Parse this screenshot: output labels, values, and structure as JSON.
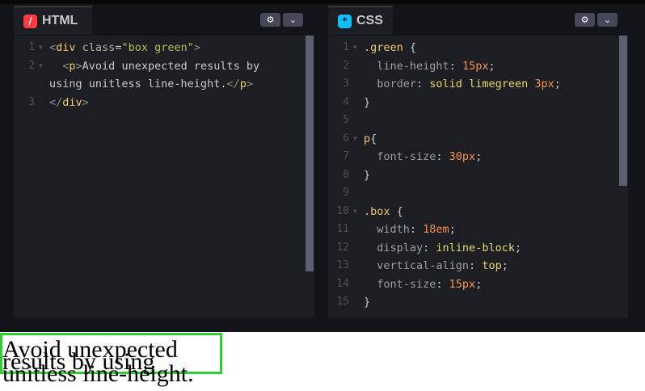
{
  "html_panel": {
    "title": "HTML",
    "icon": "html-icon",
    "icon_glyph": "/",
    "settings_icon": "gear-icon",
    "collapse_icon": "chevron-down-icon",
    "lines": [
      {
        "n": "1",
        "fold": true,
        "segments": [
          {
            "t": "<",
            "c": "tagbr"
          },
          {
            "t": "div",
            "c": "tname"
          },
          {
            "t": " class",
            "c": "attr"
          },
          {
            "t": "=",
            "c": "brace"
          },
          {
            "t": "\"box green\"",
            "c": "str"
          },
          {
            "t": ">",
            "c": "tagbr"
          }
        ]
      },
      {
        "n": "2",
        "fold": true,
        "segments": [
          {
            "t": "  <",
            "c": "tagbr"
          },
          {
            "t": "p",
            "c": "tname"
          },
          {
            "t": ">",
            "c": "tagbr"
          },
          {
            "t": "Avoid unexpected results by",
            "c": "brace"
          }
        ]
      },
      {
        "n": "",
        "fold": false,
        "segments": [
          {
            "t": "using unitless line-height.",
            "c": "brace"
          },
          {
            "t": "</",
            "c": "tagbr"
          },
          {
            "t": "p",
            "c": "tname"
          },
          {
            "t": ">",
            "c": "tagbr"
          }
        ]
      },
      {
        "n": "3",
        "fold": false,
        "segments": [
          {
            "t": "</",
            "c": "tagbr"
          },
          {
            "t": "div",
            "c": "tname"
          },
          {
            "t": ">",
            "c": "tagbr"
          }
        ]
      }
    ]
  },
  "css_panel": {
    "title": "CSS",
    "icon": "css-icon",
    "icon_glyph": "*",
    "settings_icon": "gear-icon",
    "collapse_icon": "chevron-down-icon",
    "lines": [
      {
        "n": "1",
        "fold": true,
        "segments": [
          {
            "t": ".green",
            "c": "sel"
          },
          {
            "t": " {",
            "c": "brace"
          }
        ]
      },
      {
        "n": "2",
        "fold": false,
        "segments": [
          {
            "t": "  line-height",
            "c": "prop2"
          },
          {
            "t": ": ",
            "c": "brace"
          },
          {
            "t": "15px",
            "c": "num"
          },
          {
            "t": ";",
            "c": "brace"
          }
        ]
      },
      {
        "n": "3",
        "fold": false,
        "segments": [
          {
            "t": "  border",
            "c": "prop2"
          },
          {
            "t": ": ",
            "c": "brace"
          },
          {
            "t": "solid",
            "c": "kw"
          },
          {
            "t": " ",
            "c": "brace"
          },
          {
            "t": "limegreen",
            "c": "kw"
          },
          {
            "t": " ",
            "c": "brace"
          },
          {
            "t": "3px",
            "c": "num"
          },
          {
            "t": ";",
            "c": "brace"
          }
        ]
      },
      {
        "n": "4",
        "fold": false,
        "segments": [
          {
            "t": "}",
            "c": "brace"
          }
        ]
      },
      {
        "n": "5",
        "fold": false,
        "segments": []
      },
      {
        "n": "6",
        "fold": true,
        "segments": [
          {
            "t": "p",
            "c": "sel"
          },
          {
            "t": "{",
            "c": "brace"
          }
        ]
      },
      {
        "n": "7",
        "fold": false,
        "segments": [
          {
            "t": "  font-size",
            "c": "prop2"
          },
          {
            "t": ": ",
            "c": "brace"
          },
          {
            "t": "30px",
            "c": "num"
          },
          {
            "t": ";",
            "c": "brace"
          }
        ]
      },
      {
        "n": "8",
        "fold": false,
        "segments": [
          {
            "t": "}",
            "c": "brace"
          }
        ]
      },
      {
        "n": "9",
        "fold": false,
        "segments": []
      },
      {
        "n": "10",
        "fold": true,
        "segments": [
          {
            "t": ".box",
            "c": "sel"
          },
          {
            "t": " {",
            "c": "brace"
          }
        ]
      },
      {
        "n": "11",
        "fold": false,
        "segments": [
          {
            "t": "  width",
            "c": "prop2"
          },
          {
            "t": ": ",
            "c": "brace"
          },
          {
            "t": "18em",
            "c": "num"
          },
          {
            "t": ";",
            "c": "brace"
          }
        ]
      },
      {
        "n": "12",
        "fold": false,
        "segments": [
          {
            "t": "  display",
            "c": "prop2"
          },
          {
            "t": ": ",
            "c": "brace"
          },
          {
            "t": "inline-block",
            "c": "kw"
          },
          {
            "t": ";",
            "c": "brace"
          }
        ]
      },
      {
        "n": "13",
        "fold": false,
        "segments": [
          {
            "t": "  vertical-align",
            "c": "prop2"
          },
          {
            "t": ": ",
            "c": "brace"
          },
          {
            "t": "top",
            "c": "kw"
          },
          {
            "t": ";",
            "c": "brace"
          }
        ]
      },
      {
        "n": "14",
        "fold": false,
        "segments": [
          {
            "t": "  font-size",
            "c": "prop2"
          },
          {
            "t": ": ",
            "c": "brace"
          },
          {
            "t": "15px",
            "c": "num"
          },
          {
            "t": ";",
            "c": "brace"
          }
        ]
      },
      {
        "n": "15",
        "fold": false,
        "segments": [
          {
            "t": "}",
            "c": "brace"
          }
        ]
      }
    ]
  },
  "preview": {
    "text": "Avoid unexpected results by using unitless line-height.",
    "border_color": "#32cd32"
  }
}
